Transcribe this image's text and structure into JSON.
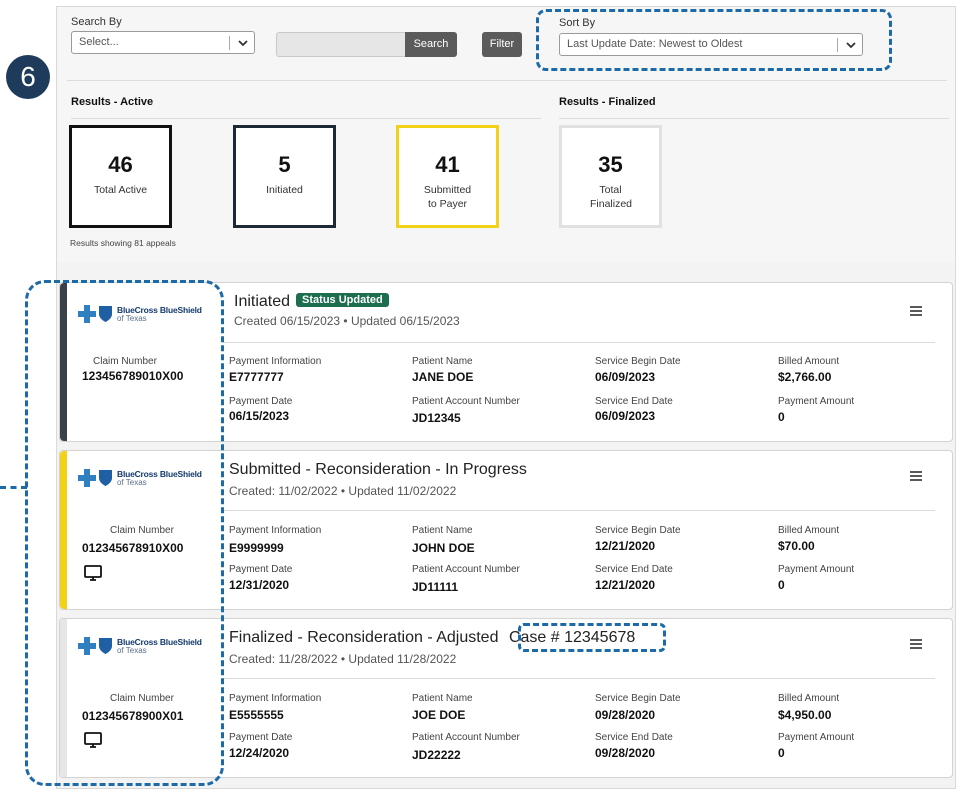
{
  "step_marker": "6",
  "search": {
    "search_by_label": "Search By",
    "select_placeholder": "Select...",
    "search_button": "Search",
    "filter_button": "Filter",
    "sort_by_label": "Sort By",
    "sort_value": "Last Update Date: Newest to Oldest"
  },
  "results": {
    "active_title": "Results - Active",
    "finalized_title": "Results - Finalized",
    "stats": [
      {
        "value": "46",
        "label": "Total Active",
        "border": "#111111"
      },
      {
        "value": "5",
        "label": "Initiated",
        "border": "#1d2a35"
      },
      {
        "value": "41",
        "label": "Submitted to Payer",
        "border": "#f2d216"
      },
      {
        "value": "35",
        "label": "Total Finalized",
        "border": "#e1e1e1"
      }
    ],
    "showing_note": "Results showing 81 appeals"
  },
  "brand": {
    "name": "BlueCross BlueShield",
    "region": "of Texas"
  },
  "field_labels": {
    "claim_number": "Claim Number",
    "payment_information": "Payment Information",
    "patient_name": "Patient Name",
    "service_begin_date": "Service Begin Date",
    "billed_amount": "Billed Amount",
    "payment_date": "Payment Date",
    "patient_account_number": "Patient Account Number",
    "service_end_date": "Service End Date",
    "payment_amount": "Payment Amount"
  },
  "cards": [
    {
      "status": "Initiated",
      "badge": "Status Updated",
      "dates": "Created 06/15/2023  • Updated 06/15/2023",
      "accent": "#3a4148",
      "claim_number": "123456789010X00",
      "payment_information": "E7777777",
      "patient_name": "JANE DOE",
      "service_begin_date": "06/09/2023",
      "billed_amount": "$2,766.00",
      "payment_date": "06/15/2023",
      "patient_account_number": "JD12345",
      "service_end_date": "06/09/2023",
      "payment_amount": "0"
    },
    {
      "status": "Submitted - Reconsideration - In Progress",
      "dates": "Created: 11/02/2022 • Updated 11/02/2022",
      "accent": "#f2d216",
      "claim_number": "012345678910X00",
      "payment_information": "E9999999",
      "patient_name": "JOHN DOE",
      "service_begin_date": "12/21/2020",
      "billed_amount": "$70.00",
      "payment_date": "12/31/2020",
      "patient_account_number": "JD11111",
      "service_end_date": "12/21/2020",
      "payment_amount": "0"
    },
    {
      "status": "Finalized - Reconsideration - Adjusted",
      "case_number": "Case # 12345678",
      "dates": "Created: 11/28/2022 • Updated 11/28/2022",
      "accent": "#e6e6e6",
      "claim_number": "012345678900X01",
      "payment_information": "E5555555",
      "patient_name": "JOE DOE",
      "service_begin_date": "09/28/2020",
      "billed_amount": "$4,950.00",
      "payment_date": "12/24/2020",
      "patient_account_number": "JD22222",
      "service_end_date": "09/28/2020",
      "payment_amount": "0"
    }
  ],
  "icons": {
    "menu": "hamburger-menu-icon",
    "channel": "desktop-monitor-icon",
    "dropdown": "chevron-down-icon"
  },
  "colors": {
    "callout": "#1d6aa8",
    "badge": "#1c6e4f",
    "step_marker": "#1f3b5c"
  }
}
